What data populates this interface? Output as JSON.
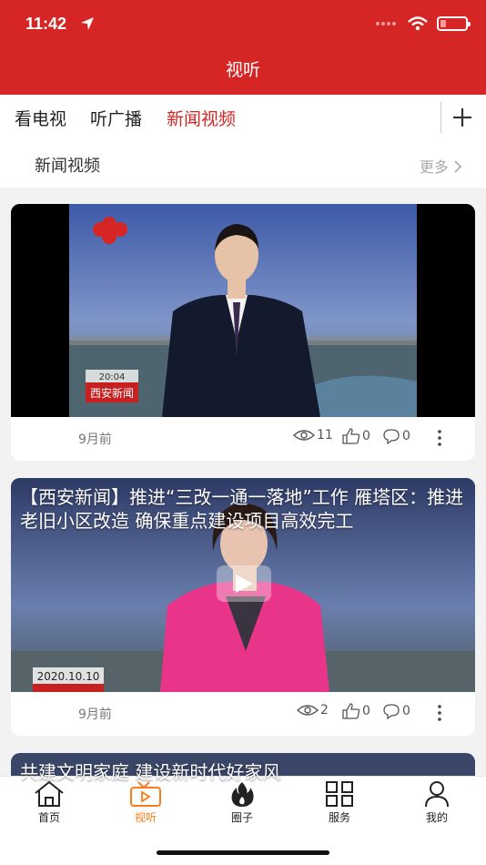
{
  "status": {
    "time": "11:42"
  },
  "header": {
    "title": "视听"
  },
  "tabs": [
    {
      "label": "看电视"
    },
    {
      "label": "听广播"
    },
    {
      "label": "新闻视频"
    }
  ],
  "section": {
    "title": "新闻视频",
    "more": "更多"
  },
  "videos": [
    {
      "overlay_title": "",
      "logo_text": "西安新闻",
      "logo_time": "20:04",
      "time_ago": "9月前",
      "views": "11",
      "likes": "0",
      "comments": "0"
    },
    {
      "overlay_title": "【西安新闻】推进“三改一通一落地”工作 雁塔区：推进老旧小区改造 确保重点建设项目高效完工",
      "date_badge": "2020.10.10",
      "time_ago": "9月前",
      "views": "2",
      "likes": "0",
      "comments": "0"
    },
    {
      "overlay_title": "共建文明家庭 建设新时代好家风"
    }
  ],
  "bottom_nav": [
    {
      "label": "首页",
      "icon": "home-icon"
    },
    {
      "label": "视听",
      "icon": "video-icon",
      "active": true
    },
    {
      "label": "圈子",
      "icon": "flame-icon"
    },
    {
      "label": "服务",
      "icon": "grid-icon"
    },
    {
      "label": "我的",
      "icon": "user-icon"
    }
  ],
  "colors": {
    "brand_red": "#d62525",
    "active_orange": "#ff7a1a"
  }
}
